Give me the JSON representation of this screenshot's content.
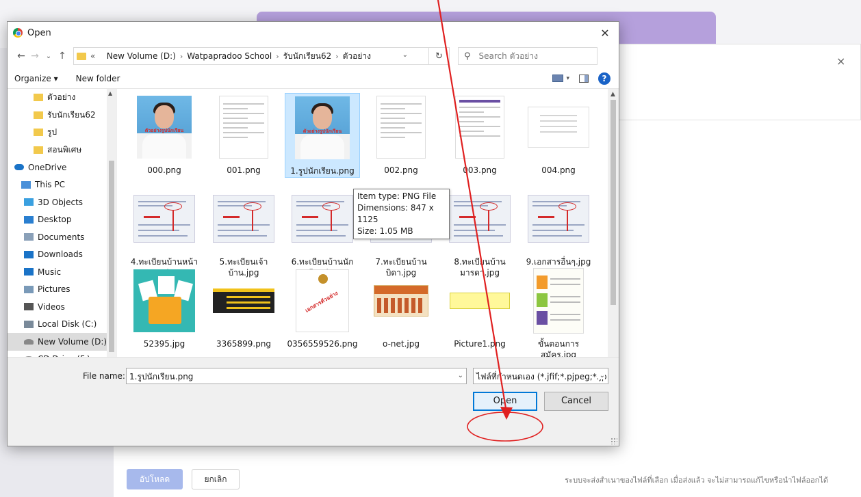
{
  "background": {
    "upload_label": "อัปโหลด",
    "cancel_label": "ยกเลิก",
    "note": "ระบบจะส่งสำเนาของไฟล์ที่เลือก เมื่อส่งแล้ว จะไม่สามารถแก้ไขหรือนำไฟล์ออกได้",
    "close_glyph": "×"
  },
  "dialog": {
    "title": "Open",
    "close_glyph": "✕",
    "address": {
      "overflow": "«",
      "crumbs": [
        "New Volume (D:)",
        "Watpapradoo School",
        "รับนักเรียน62",
        "ตัวอย่าง"
      ]
    },
    "search_placeholder": "Search ตัวอย่าง",
    "toolbar": {
      "organize": "Organize ▾",
      "new_folder": "New folder",
      "help": "?"
    },
    "nav": [
      {
        "label": "ตัวอย่าง",
        "icon": "folder-icon",
        "color": "#f2c94c"
      },
      {
        "label": "รับนักเรียน62",
        "icon": "folder-icon",
        "color": "#f2c94c"
      },
      {
        "label": "รูป",
        "icon": "folder-icon",
        "color": "#f2c94c"
      },
      {
        "label": "สอนพิเศษ",
        "icon": "folder-icon",
        "color": "#f2c94c"
      },
      {
        "label": "OneDrive",
        "icon": "cloud-icon",
        "color": "#1a73c7"
      },
      {
        "label": "This PC",
        "icon": "computer-icon",
        "color": "#4a90d9"
      },
      {
        "label": "3D Objects",
        "icon": "cube-icon",
        "color": "#3aa0e0"
      },
      {
        "label": "Desktop",
        "icon": "desktop-icon",
        "color": "#2a7fd0"
      },
      {
        "label": "Documents",
        "icon": "documents-icon",
        "color": "#8aa0b8"
      },
      {
        "label": "Downloads",
        "icon": "download-icon",
        "color": "#1a73c7"
      },
      {
        "label": "Music",
        "icon": "music-icon",
        "color": "#1a73c7"
      },
      {
        "label": "Pictures",
        "icon": "pictures-icon",
        "color": "#7a9ab8"
      },
      {
        "label": "Videos",
        "icon": "videos-icon",
        "color": "#555"
      },
      {
        "label": "Local Disk (C:)",
        "icon": "disk-icon",
        "color": "#7a8a9a"
      },
      {
        "label": "New Volume (D:)",
        "icon": "drive-icon",
        "color": "#888"
      },
      {
        "label": "CD Drive (F:)",
        "icon": "cd-icon",
        "color": "#999"
      }
    ],
    "files": [
      {
        "line1": "000.png",
        "line2": "",
        "thumb": "photo-girl"
      },
      {
        "line1": "001.png",
        "line2": "",
        "thumb": "doc"
      },
      {
        "line1": "1.รูปนักเรียน.png",
        "line2": "",
        "thumb": "photo-boy"
      },
      {
        "line1": "002.png",
        "line2": "",
        "thumb": "doc"
      },
      {
        "line1": "003.png",
        "line2": "",
        "thumb": "doc-purple"
      },
      {
        "line1": "004.png",
        "line2": "",
        "thumb": "wide"
      },
      {
        "line1": "4.ทะเบียนบ้านหน้า",
        "line2": "แรก.jpg",
        "thumb": "house"
      },
      {
        "line1": "5.ทะเบียนเจ้า",
        "line2": "บ้าน.jpg",
        "thumb": "house"
      },
      {
        "line1": "6.ทะเบียนบ้านนัก",
        "line2": "เรียน.jpg",
        "thumb": "house"
      },
      {
        "line1": "7.ทะเบียนบ้าน",
        "line2": "บิดา.jpg",
        "thumb": "house"
      },
      {
        "line1": "8.ทะเบียนบ้าน",
        "line2": "มารดา.jpg",
        "thumb": "house"
      },
      {
        "line1": "9.เอกสารอื่นๆ.jpg",
        "line2": "",
        "thumb": "house"
      },
      {
        "line1": "52395.jpg",
        "line2": "",
        "thumb": "folder"
      },
      {
        "line1": "3365899.png",
        "line2": "",
        "thumb": "ticket"
      },
      {
        "line1": "0356559526.png",
        "line2": "",
        "thumb": "cert"
      },
      {
        "line1": "o-net.jpg",
        "line2": "",
        "thumb": "onet"
      },
      {
        "line1": "Picture1.png",
        "line2": "",
        "thumb": "pic1"
      },
      {
        "line1": "ขั้นตอนการ",
        "line2": "สมัคร.jpg",
        "thumb": "steps"
      }
    ],
    "selected_index": 2,
    "tooltip": {
      "type": "Item type: PNG File",
      "dims": "Dimensions: 847 x 1125",
      "size": "Size: 1.05 MB"
    },
    "footer": {
      "file_name_label": "File name:",
      "file_name_value": "1.รูปนักเรียน.png",
      "file_type": "ไฟล์ที่กำหนดเอง (*.jfif;*.pjpeg;*.jp",
      "open_label": "Open",
      "cancel_label": "Cancel"
    }
  },
  "thumb_text": {
    "photo_stamp": "ตัวอย่างรูปนักเรียน",
    "cert_watermark": "เอกสารตัวอย่าง"
  },
  "colors": {
    "accent": "#0078d7",
    "annotation": "#e02020",
    "purple_header": "#b5a0dc"
  }
}
